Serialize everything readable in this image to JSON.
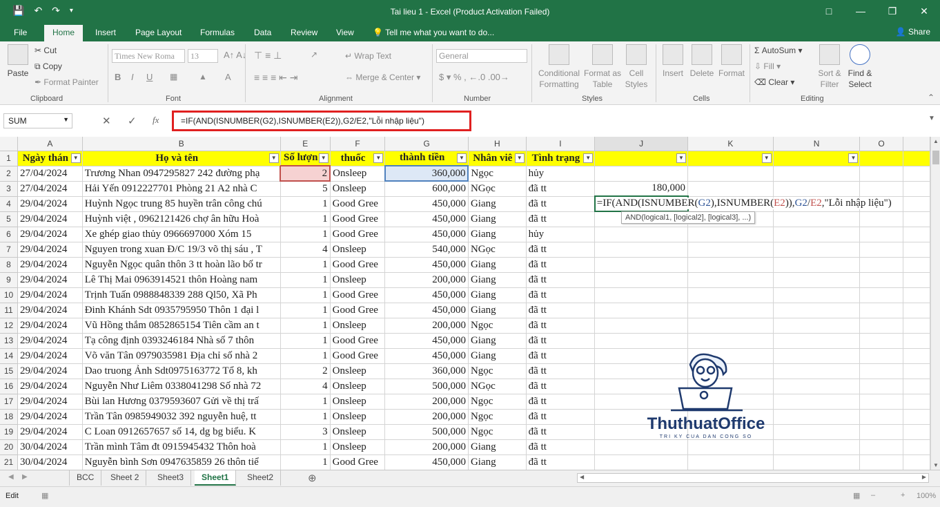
{
  "titlebar": {
    "title": "Tai lieu 1 - Excel (Product Activation Failed)"
  },
  "tabs": [
    "File",
    "Home",
    "Insert",
    "Page Layout",
    "Formulas",
    "Data",
    "Review",
    "View"
  ],
  "tell_me": "Tell me what you want to do...",
  "share": "Share",
  "ribbon": {
    "clipboard": {
      "paste": "Paste",
      "cut": "Cut",
      "copy": "Copy",
      "format_painter": "Format Painter",
      "label": "Clipboard"
    },
    "font": {
      "name": "Times New Roma",
      "size": "13",
      "label": "Font"
    },
    "alignment": {
      "wrap": "Wrap Text",
      "merge": "Merge & Center",
      "label": "Alignment"
    },
    "number": {
      "format": "General",
      "label": "Number"
    },
    "styles": {
      "cond": "Conditional Formatting",
      "table": "Format as Table",
      "cell": "Cell Styles",
      "label": "Styles"
    },
    "cells": {
      "insert": "Insert",
      "delete": "Delete",
      "format": "Format",
      "label": "Cells"
    },
    "editing": {
      "autosum": "AutoSum",
      "fill": "Fill",
      "clear": "Clear",
      "sort": "Sort & Filter",
      "find": "Find & Select",
      "label": "Editing"
    }
  },
  "namebox": "SUM",
  "formula": "=IF(AND(ISNUMBER(G2),ISNUMBER(E2)),G2/E2,\"Lỗi nhập liệu\")",
  "editing_cell": {
    "p1": "=IF(AND(ISNUMBER(",
    "g": "G2",
    "p2": "),ISNUMBER(",
    "e": "E2",
    "p3": ")),",
    "g2": "G2",
    "slash": "/",
    "e2": "E2",
    "p4": ",\"Lỗi nhập liệu\")"
  },
  "tooltip": "AND(logical1, [logical2], [logical3], ...)",
  "columns": [
    "A",
    "B",
    "E",
    "F",
    "G",
    "H",
    "I",
    "J",
    "K",
    "N",
    "O"
  ],
  "headers": {
    "a": "Ngày thán",
    "b": "Họ và tên",
    "e": "Số lượn",
    "f": "thuốc",
    "g": "thành tiền",
    "h": "Nhân viê",
    "i": "Tình trạng"
  },
  "j3": "180,000",
  "rows": [
    {
      "n": "2",
      "a": "27/04/2024",
      "b": "Trương Nhan 0947295827 242 đường phạ",
      "e": "2",
      "f": "Onsleep",
      "g": "360,000",
      "h": "Ngọc",
      "i": "hủy"
    },
    {
      "n": "3",
      "a": "27/04/2024",
      "b": "Hải Yến 0912227701 Phòng 21 A2 nhà C",
      "e": "5",
      "f": "Onsleep",
      "g": "600,000",
      "h": "NGọc",
      "i": "đã tt"
    },
    {
      "n": "4",
      "a": "29/04/2024",
      "b": "Huỳnh Ngọc trung 85 huyền trân công chú",
      "e": "1",
      "f": "Good Gree",
      "g": "450,000",
      "h": "Giang",
      "i": "đã tt"
    },
    {
      "n": "5",
      "a": "29/04/2024",
      "b": "Huỳnh việt , 0962121426 chợ ân hữu Hoà",
      "e": "1",
      "f": "Good Gree",
      "g": "450,000",
      "h": "Giang",
      "i": "đã tt"
    },
    {
      "n": "6",
      "a": "29/04/2024",
      "b": " Xe ghép giao thủy 0966697000 Xóm 15",
      "e": "1",
      "f": "Good Gree",
      "g": "450,000",
      "h": "Giang",
      "i": "hủy"
    },
    {
      "n": "7",
      "a": "29/04/2024",
      "b": "Nguyen trong xuan Đ/C 19/3 võ thị sáu , T",
      "e": "4",
      "f": "Onsleep",
      "g": "540,000",
      "h": "NGọc",
      "i": "đã tt"
    },
    {
      "n": "8",
      "a": "29/04/2024",
      "b": "Nguyễn Ngọc quân thôn 3 tt hoàn lão bố tr",
      "e": "1",
      "f": "Good Gree",
      "g": "450,000",
      "h": "Giang",
      "i": "đã tt"
    },
    {
      "n": "9",
      "a": "29/04/2024",
      "b": "Lê Thị Mai 0963914521 thôn Hoàng nam",
      "e": "1",
      "f": "Onsleep",
      "g": "200,000",
      "h": "Giang",
      "i": "đã tt"
    },
    {
      "n": "10",
      "a": "29/04/2024",
      "b": "Trịnh Tuấn 0988848339 288 Ql50, Xã Ph",
      "e": "1",
      "f": "Good Gree",
      "g": "450,000",
      "h": "Giang",
      "i": "đã tt"
    },
    {
      "n": "11",
      "a": "29/04/2024",
      "b": "Đinh Khánh Sdt 0935795950 Thôn 1 đại l",
      "e": "1",
      "f": "Good Gree",
      "g": "450,000",
      "h": "Giang",
      "i": "đã tt"
    },
    {
      "n": "12",
      "a": "29/04/2024",
      "b": "Vũ Hồng thắm 0852865154 Tiên cầm an t",
      "e": "1",
      "f": "Onsleep",
      "g": "200,000",
      "h": "Ngọc",
      "i": "đã tt"
    },
    {
      "n": "13",
      "a": "29/04/2024",
      "b": "Tạ công định 0393246184 Nhà số 7 thôn",
      "e": "1",
      "f": "Good Gree",
      "g": "450,000",
      "h": "Giang",
      "i": "đã tt"
    },
    {
      "n": "14",
      "a": "29/04/2024",
      "b": " Võ văn Tân 0979035981 Địa chỉ số nhà 2",
      "e": "1",
      "f": "Good Gree",
      "g": "450,000",
      "h": "Giang",
      "i": "đã tt"
    },
    {
      "n": "15",
      "a": "29/04/2024",
      "b": "Dao truong Ảnh  Sdt0975163772 Tổ 8, kh",
      "e": "2",
      "f": "Onsleep",
      "g": "360,000",
      "h": "Ngọc",
      "i": "đã tt"
    },
    {
      "n": "16",
      "a": "29/04/2024",
      "b": "Nguyễn Như Liêm 0338041298 Số nhà 72",
      "e": "4",
      "f": "Onsleep",
      "g": "500,000",
      "h": "NGọc",
      "i": "đã tt"
    },
    {
      "n": "17",
      "a": "29/04/2024",
      "b": "Bùi lan Hương 0379593607 Gửi về thị trấ",
      "e": "1",
      "f": "Onsleep",
      "g": "200,000",
      "h": "Ngọc",
      "i": "đã tt"
    },
    {
      "n": "18",
      "a": "29/04/2024",
      "b": "Trần Tân 0985949032 392  nguyễn huệ, tt",
      "e": "1",
      "f": "Onsleep",
      "g": "200,000",
      "h": "Ngọc",
      "i": "đã tt"
    },
    {
      "n": "19",
      "a": "29/04/2024",
      "b": "C Loan 0912657657 số 14, dg bg biểu. K",
      "e": "3",
      "f": "Onsleep",
      "g": "500,000",
      "h": "Ngọc",
      "i": "đã tt"
    },
    {
      "n": "20",
      "a": "30/04/2024",
      "b": " Trần mình Tâm đt 0915945432 Thôn hoà",
      "e": "1",
      "f": "Onsleep",
      "g": "200,000",
      "h": "Giang",
      "i": "đã tt"
    },
    {
      "n": "21",
      "a": "30/04/2024",
      "b": "Nguyễn bình Sơn 0947635859 26 thôn tiể",
      "e": "1",
      "f": "Good Gree",
      "g": "450,000",
      "h": "Giang",
      "i": "đã tt"
    }
  ],
  "sheets": [
    "BCC",
    "Sheet 2",
    "Sheet3",
    "Sheet1",
    "Sheet2"
  ],
  "status": "Edit",
  "zoom": "100%",
  "watermark": {
    "brand": "ThuthuatOffice",
    "tagline": "TRI KY CUA DAN CONG SO"
  },
  "colors": {
    "excel_green": "#217346",
    "header_fill": "#ffff00",
    "highlight": "#e02020"
  }
}
